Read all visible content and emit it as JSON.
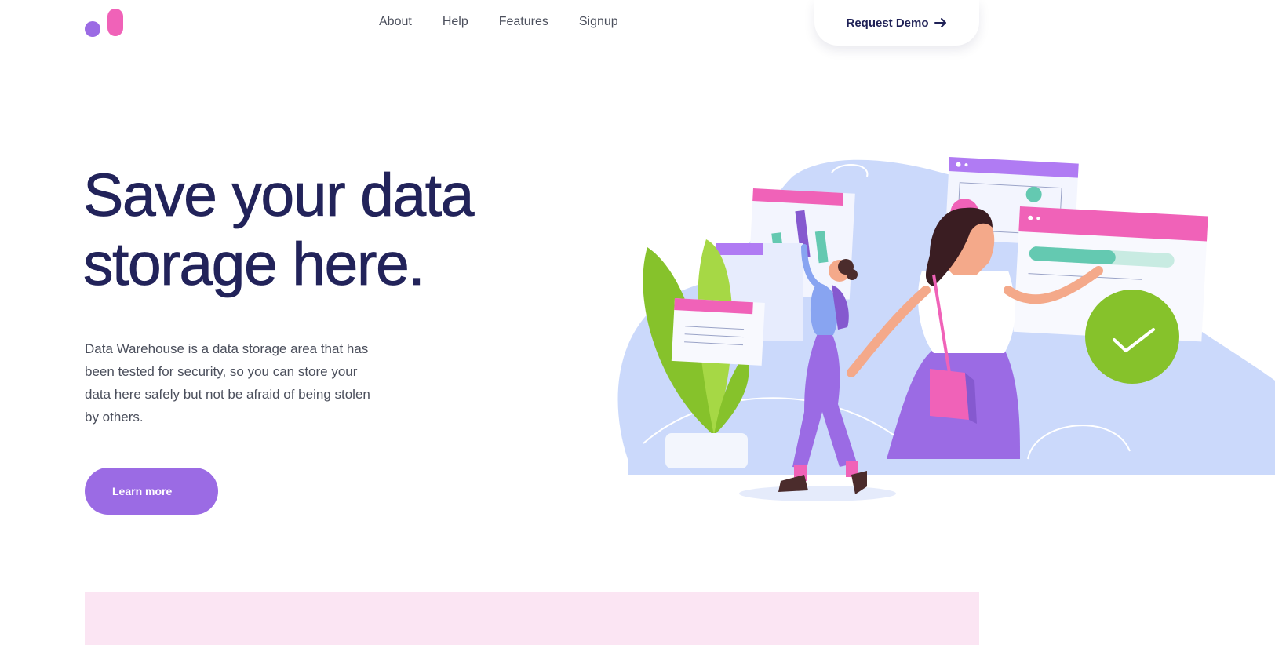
{
  "nav": {
    "links": [
      "About",
      "Help",
      "Features",
      "Signup"
    ],
    "cta_label": "Request Demo"
  },
  "hero": {
    "title": "Save your data storage here.",
    "description": "Data Warehouse is a data storage area that has been tested for security, so you can store your data here safely but not be afraid of being stolen by others.",
    "button_label": "Learn more"
  },
  "colors": {
    "purple": "#9b6be4",
    "pink": "#f062b8",
    "navy": "#22235a",
    "light_blue": "#cbd9fb",
    "green": "#86c22b",
    "band_pink": "#fbe5f3"
  },
  "icons": [
    "logo-mark",
    "arrow-right-icon",
    "checkmark-icon"
  ]
}
